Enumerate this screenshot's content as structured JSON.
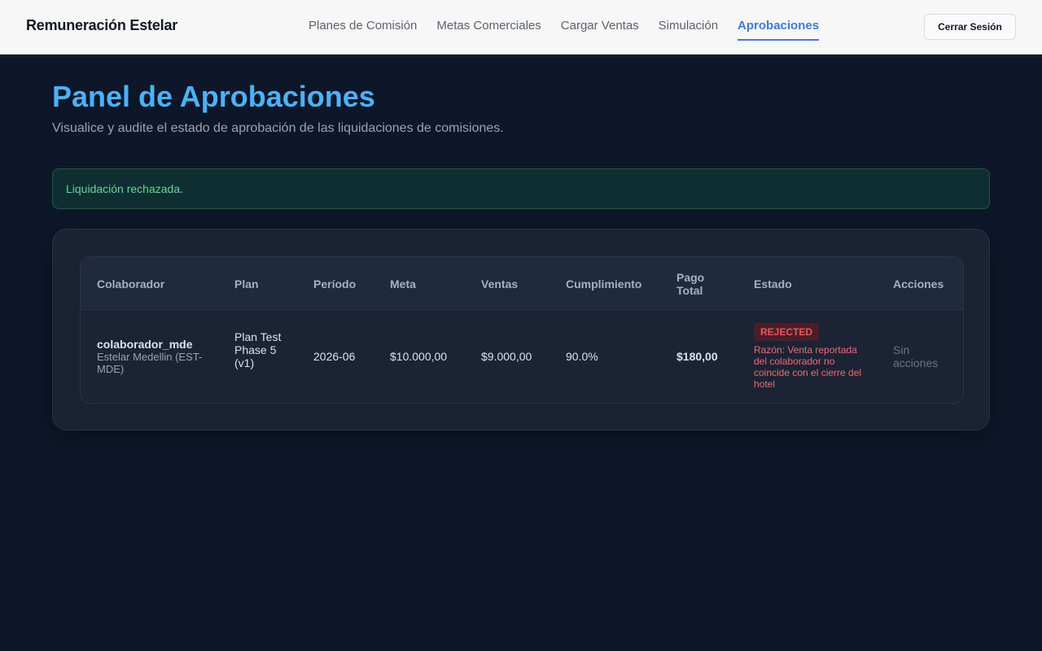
{
  "header": {
    "brand": "Remuneración Estelar",
    "nav": [
      {
        "label": "Planes de Comisión",
        "active": false
      },
      {
        "label": "Metas Comerciales",
        "active": false
      },
      {
        "label": "Cargar Ventas",
        "active": false
      },
      {
        "label": "Simulación",
        "active": false
      },
      {
        "label": "Aprobaciones",
        "active": true
      }
    ],
    "logout_label": "Cerrar Sesión"
  },
  "main": {
    "title": "Panel de Aprobaciones",
    "subtitle": "Visualice y audite el estado de aprobación de las liquidaciones de comisiones.",
    "alert": "Liquidación rechazada.",
    "table": {
      "columns": [
        "Colaborador",
        "Plan",
        "Período",
        "Meta",
        "Ventas",
        "Cumplimiento",
        "Pago Total",
        "Estado",
        "Acciones"
      ],
      "rows": [
        {
          "colaborador": "colaborador_mde",
          "hotel": "Estelar Medellin (EST-MDE)",
          "plan": "Plan Test Phase 5 (v1)",
          "periodo": "2026-06",
          "meta": "$10.000,00",
          "ventas": "$9.000,00",
          "cumplimiento": "90.0%",
          "pago_total": "$180,00",
          "estado": "REJECTED",
          "razon": "Razón: Venta reportada del colaborador no coincide con el cierre del hotel",
          "acciones": "Sin acciones"
        }
      ]
    }
  },
  "colors": {
    "background": "#0e172a",
    "accent": "#3b7bdc",
    "title": "#4bb2f6",
    "success": "#69d49a",
    "danger": "#f0525c"
  }
}
